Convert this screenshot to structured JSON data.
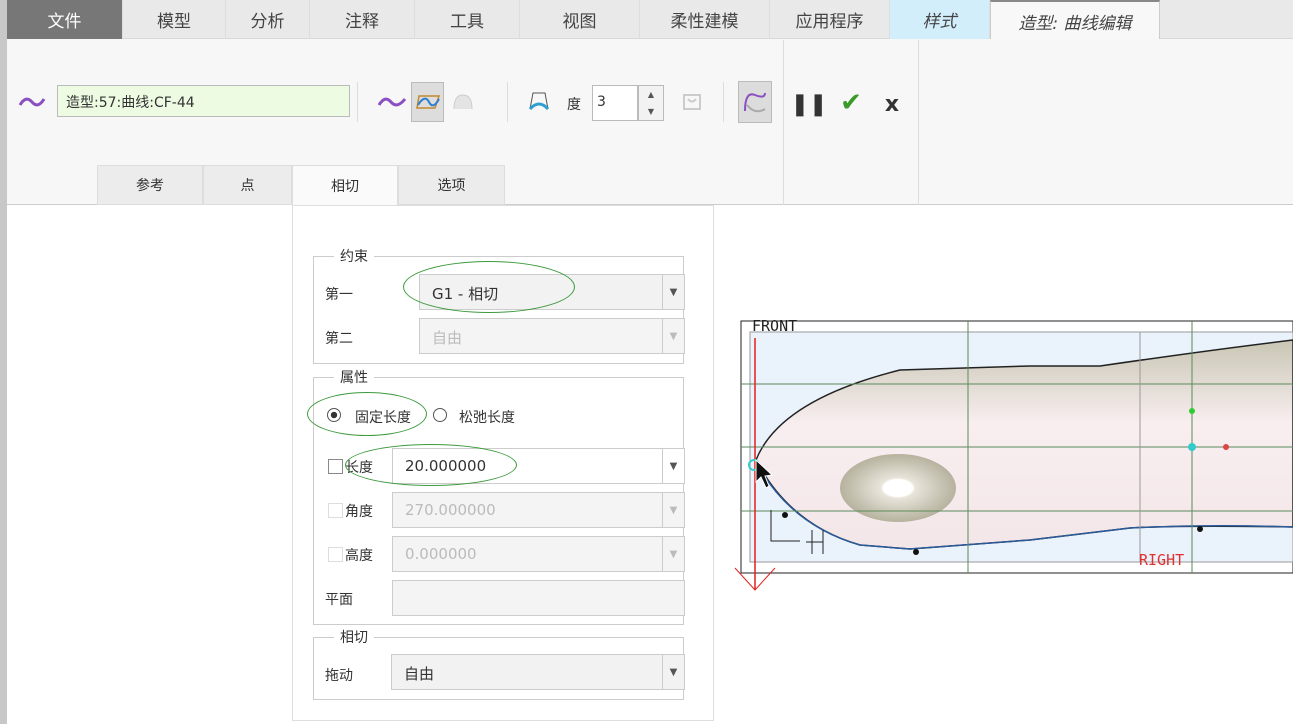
{
  "tabs": [
    {
      "label": "文件"
    },
    {
      "label": "模型"
    },
    {
      "label": "分析"
    },
    {
      "label": "注释"
    },
    {
      "label": "工具"
    },
    {
      "label": "视图"
    },
    {
      "label": "柔性建模"
    },
    {
      "label": "应用程序"
    },
    {
      "label": "样式"
    },
    {
      "label": "造型: 曲线编辑"
    }
  ],
  "ribbon": {
    "curve_name": "造型:57:曲线:CF-44",
    "degree_label": "度",
    "degree_value": "3"
  },
  "subtabs": [
    {
      "label": "参考"
    },
    {
      "label": "点"
    },
    {
      "label": "相切"
    },
    {
      "label": "选项"
    }
  ],
  "panel": {
    "constraint": {
      "title": "约束",
      "first_label": "第一",
      "first_value": "G1 - 相切",
      "second_label": "第二",
      "second_value": "自由"
    },
    "properties": {
      "title": "属性",
      "fixed_length": "固定长度",
      "relaxed_length": "松弛长度",
      "length_label": "长度",
      "length_value": "20.000000",
      "angle_label": "角度",
      "angle_value": "270.000000",
      "height_label": "高度",
      "height_value": "0.000000",
      "plane_label": "平面",
      "plane_value": ""
    },
    "tangent": {
      "title": "相切",
      "drag_label": "拖动",
      "drag_value": "自由"
    }
  },
  "viewport": {
    "front_label": "FRONT",
    "right_label": "RIGHT"
  },
  "colors": {
    "accent_green": "#3d9a3d",
    "style_tab": "#d3eefb",
    "curve_field": "#eefbe3"
  }
}
